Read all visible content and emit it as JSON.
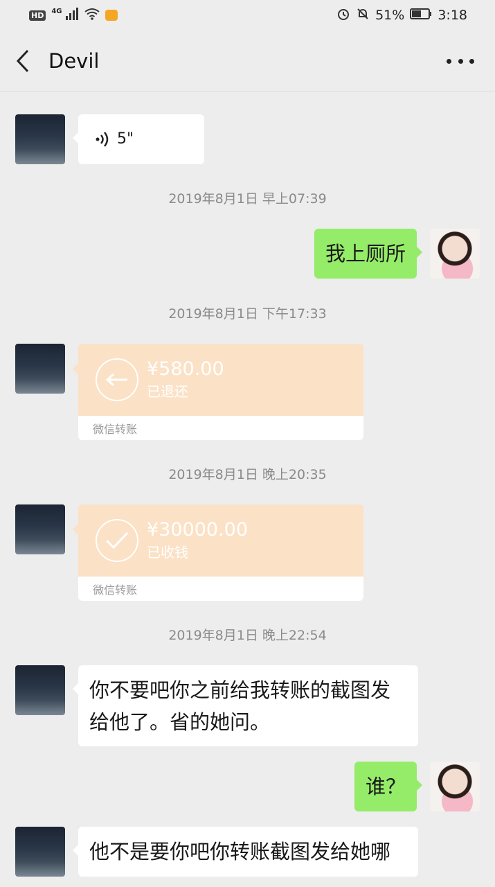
{
  "status_bar": {
    "hd": "HD",
    "network": "4G",
    "battery": "51%",
    "time": "3:18"
  },
  "header": {
    "title": "Devil"
  },
  "messages": [
    {
      "type": "voice",
      "side": "left",
      "duration": "5\""
    },
    {
      "type": "timestamp",
      "text": "2019年8月1日 早上07:39"
    },
    {
      "type": "text",
      "side": "right",
      "text": "我上厕所"
    },
    {
      "type": "timestamp",
      "text": "2019年8月1日 下午17:33"
    },
    {
      "type": "transfer",
      "side": "left",
      "amount": "¥580.00",
      "status": "已退还",
      "footer": "微信转账",
      "icon": "return-arrow-icon"
    },
    {
      "type": "timestamp",
      "text": "2019年8月1日 晚上20:35"
    },
    {
      "type": "transfer",
      "side": "left",
      "amount": "¥30000.00",
      "status": "已收钱",
      "footer": "微信转账",
      "icon": "check-icon"
    },
    {
      "type": "timestamp",
      "text": "2019年8月1日 晚上22:54"
    },
    {
      "type": "text",
      "side": "left",
      "lines": [
        "你不要吧你之前给我转账的截图发",
        "给他了。省的她问。"
      ]
    },
    {
      "type": "text",
      "side": "right",
      "text": "谁？"
    },
    {
      "type": "text",
      "side": "left",
      "text": "他不是要你吧你转账截图发给她哪"
    }
  ],
  "colors": {
    "background": "#ededed",
    "my_bubble": "#95ec69",
    "their_bubble": "#ffffff",
    "transfer_card": "#fbe1c6"
  }
}
